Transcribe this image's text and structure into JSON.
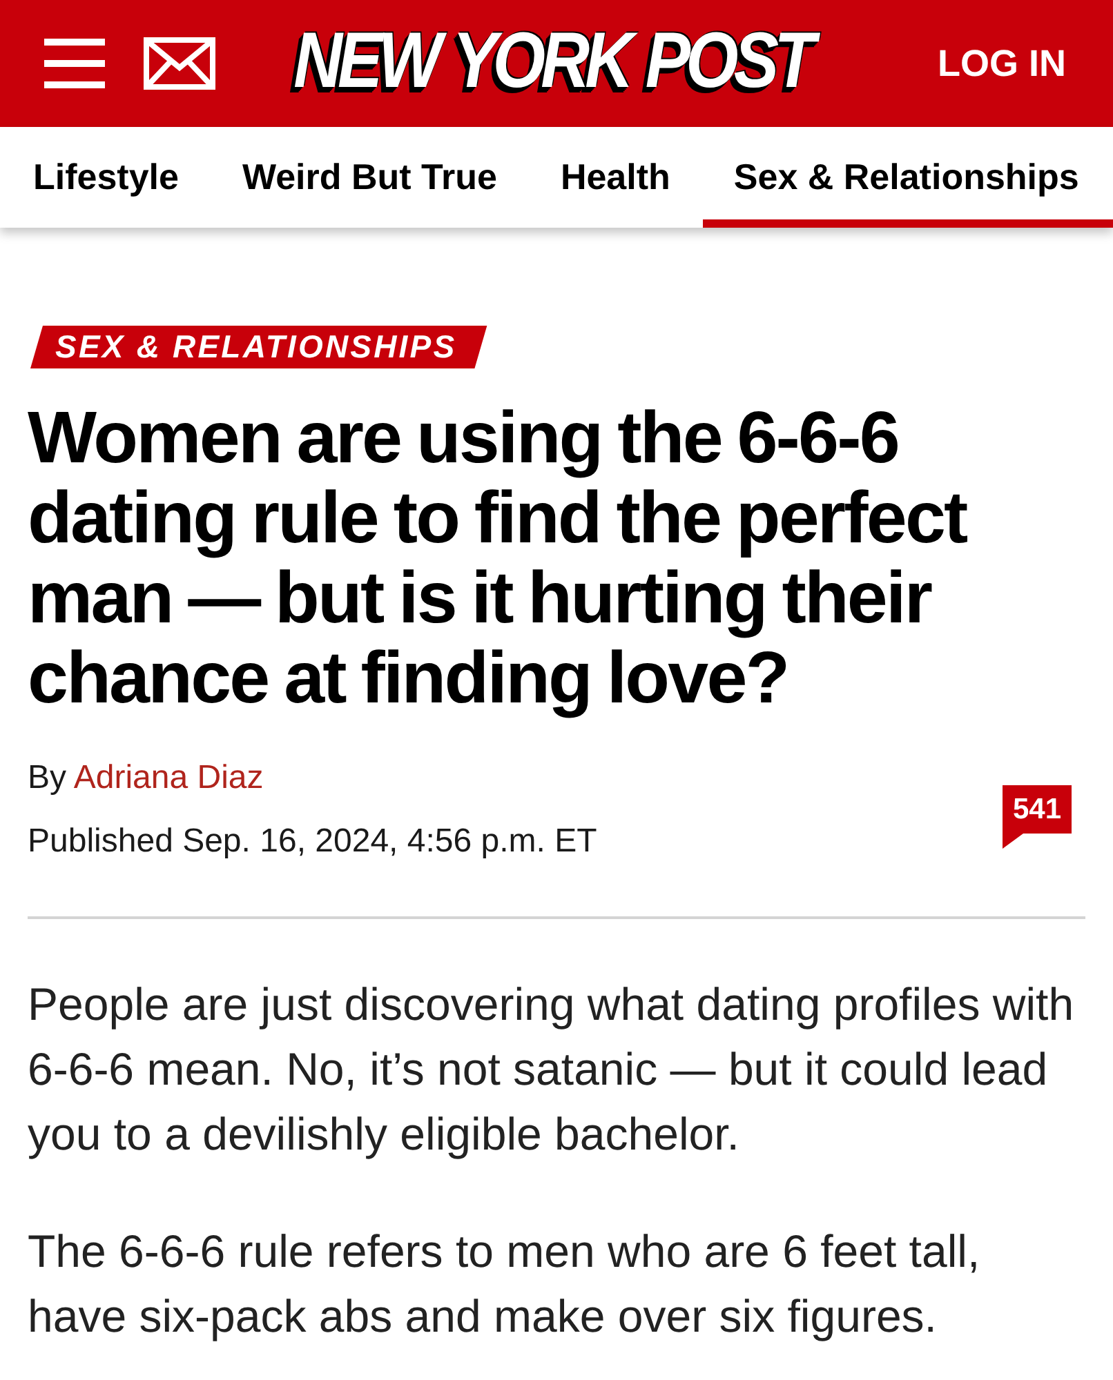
{
  "header": {
    "logo": "NEW YORK POST",
    "login": "LOG IN"
  },
  "nav": {
    "tabs": [
      {
        "label": "Lifestyle",
        "selected": false
      },
      {
        "label": "Weird But True",
        "selected": false
      },
      {
        "label": "Health",
        "selected": false
      },
      {
        "label": "Sex & Relationships",
        "selected": true
      }
    ]
  },
  "article": {
    "section_label": "SEX & RELATIONSHIPS",
    "headline": "Women are using the 6-6-6 dating rule to find the perfect man — but is it hurting their chance at finding love?",
    "byline": {
      "prefix": "By",
      "author": "Adriana Diaz"
    },
    "published": "Published Sep. 16, 2024, 4:56 p.m. ET",
    "comment_count": "541",
    "paragraphs": [
      "People are just discovering what dating profiles with 6-6-6 mean. No, it’s not satanic — but it could lead you to a devilishly eligible bachelor.",
      "The 6-6-6 rule refers to men who are 6 feet tall, have six-pack abs and make over six figures."
    ]
  }
}
